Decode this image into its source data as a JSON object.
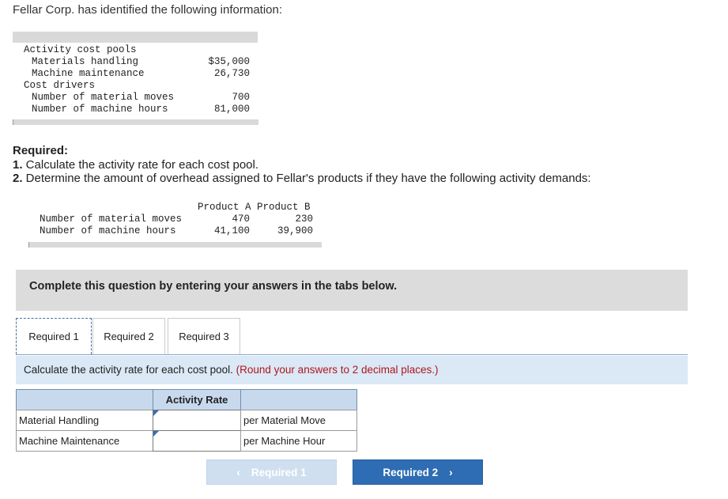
{
  "intro": "Fellar Corp. has identified the following information:",
  "info_table": {
    "pools_header": "Activity cost pools",
    "pools": [
      {
        "label": "Materials handling",
        "value": "$35,000"
      },
      {
        "label": "Machine maintenance",
        "value": "26,730"
      }
    ],
    "drivers_header": "Cost drivers",
    "drivers": [
      {
        "label": "Number of material moves",
        "value": "700"
      },
      {
        "label": "Number of machine hours",
        "value": "81,000"
      }
    ]
  },
  "required": {
    "heading": "Required:",
    "items": [
      {
        "num": "1.",
        "text": " Calculate the activity rate for each cost pool."
      },
      {
        "num": "2.",
        "text": " Determine the amount of overhead assigned to Fellar's products if they have the following activity demands:"
      }
    ]
  },
  "demand_table": {
    "header": "Product A Product B",
    "rows": [
      {
        "label": "Number of material moves",
        "a": "470",
        "b": "230"
      },
      {
        "label": "Number of machine hours",
        "a": "41,100",
        "b": "39,900"
      }
    ]
  },
  "instruction": "Complete this question by entering your answers in the tabs below.",
  "tabs": [
    "Required 1",
    "Required 2",
    "Required 3"
  ],
  "calc": {
    "text": "Calculate the activity rate for each cost pool. ",
    "note": "(Round your answers to 2 decimal places.)"
  },
  "answer_grid": {
    "header": "Activity Rate",
    "rows": [
      {
        "label": "Material Handling",
        "value": "",
        "unit": "per Material Move"
      },
      {
        "label": "Machine Maintenance",
        "value": "",
        "unit": "per Machine Hour"
      }
    ]
  },
  "buttons": {
    "prev": "Required 1",
    "next": "Required 2"
  }
}
